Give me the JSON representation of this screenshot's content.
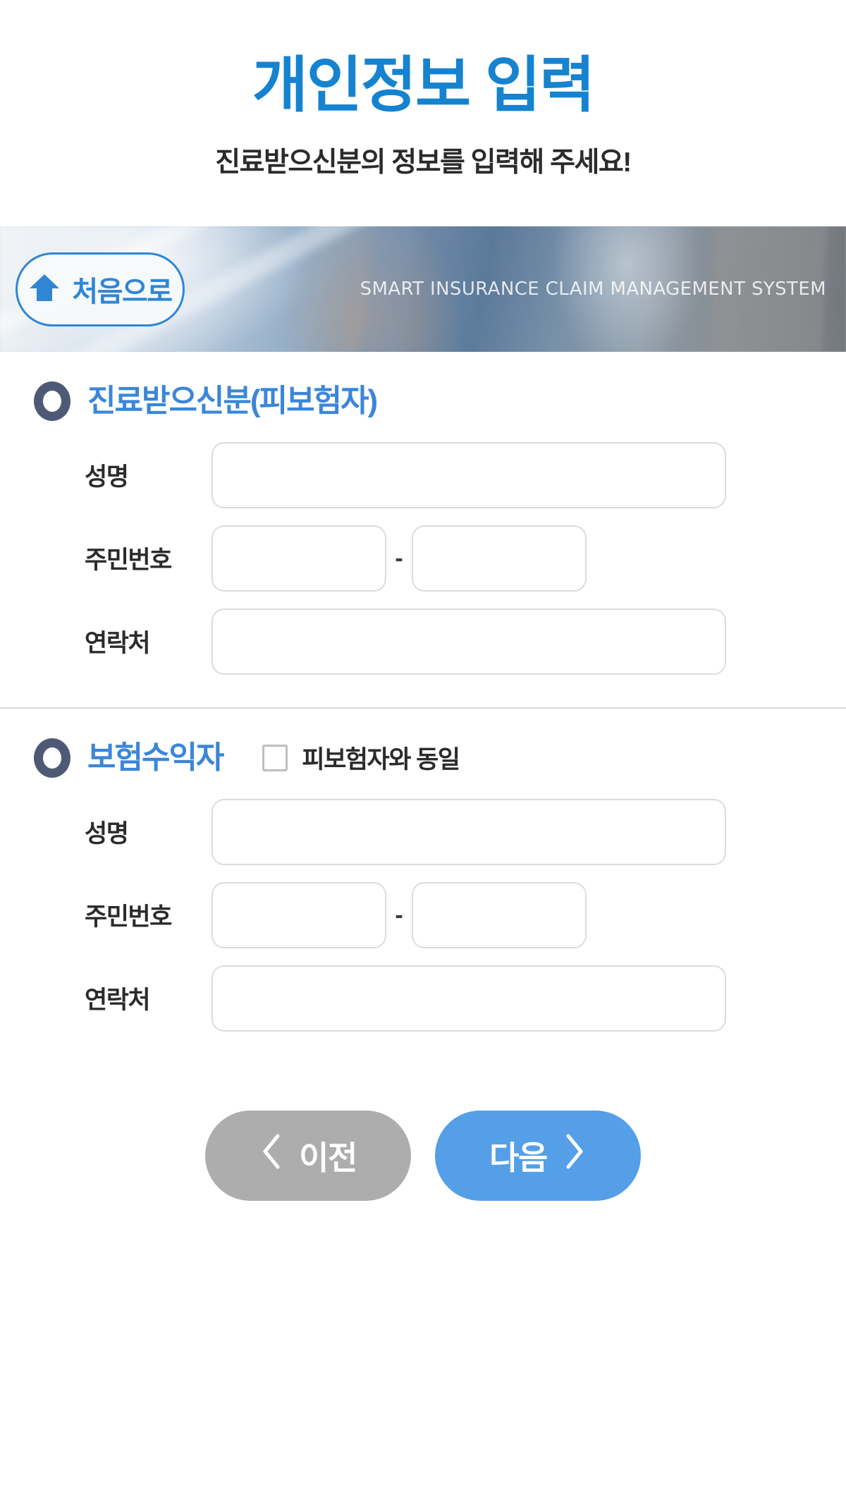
{
  "header": {
    "title": "개인정보 입력",
    "subtitle": "진료받으신분의 정보를 입력해 주세요!"
  },
  "banner": {
    "home_button_label": "처음으로",
    "home_icon": "home-icon",
    "system_text": "SMART INSURANCE CLAIM MANAGEMENT SYSTEM"
  },
  "sections": [
    {
      "id": "insured",
      "bullet_icon": "ring-bullet-icon",
      "title": "진료받으신분(피보험자)",
      "fields": [
        {
          "label": "성명",
          "type": "single",
          "value": "",
          "placeholder": ""
        },
        {
          "label": "주민번호",
          "type": "split",
          "value_front": "",
          "value_back": "",
          "separator": "-",
          "placeholder_front": "",
          "placeholder_back": ""
        },
        {
          "label": "연락처",
          "type": "single",
          "value": "",
          "placeholder": ""
        }
      ]
    },
    {
      "id": "beneficiary",
      "bullet_icon": "ring-bullet-icon",
      "title": "보험수익자",
      "same_as_insured": {
        "label": "피보험자와 동일",
        "checked": false
      },
      "fields": [
        {
          "label": "성명",
          "type": "single",
          "value": "",
          "placeholder": ""
        },
        {
          "label": "주민번호",
          "type": "split",
          "value_front": "",
          "value_back": "",
          "separator": "-",
          "placeholder_front": "",
          "placeholder_back": ""
        },
        {
          "label": "연락처",
          "type": "single",
          "value": "",
          "placeholder": ""
        }
      ]
    }
  ],
  "footer": {
    "prev_label": "이전",
    "next_label": "다음",
    "prev_icon": "chevron-left-icon",
    "next_icon": "chevron-right-icon"
  },
  "colors": {
    "title_blue": "#1583cf",
    "section_blue": "#3b86d8",
    "bullet_navy": "#4e5a75",
    "next_blue": "#549fe8",
    "prev_gray": "#adadad",
    "input_border": "#dcdcdc",
    "divider": "#d9d9d9"
  }
}
